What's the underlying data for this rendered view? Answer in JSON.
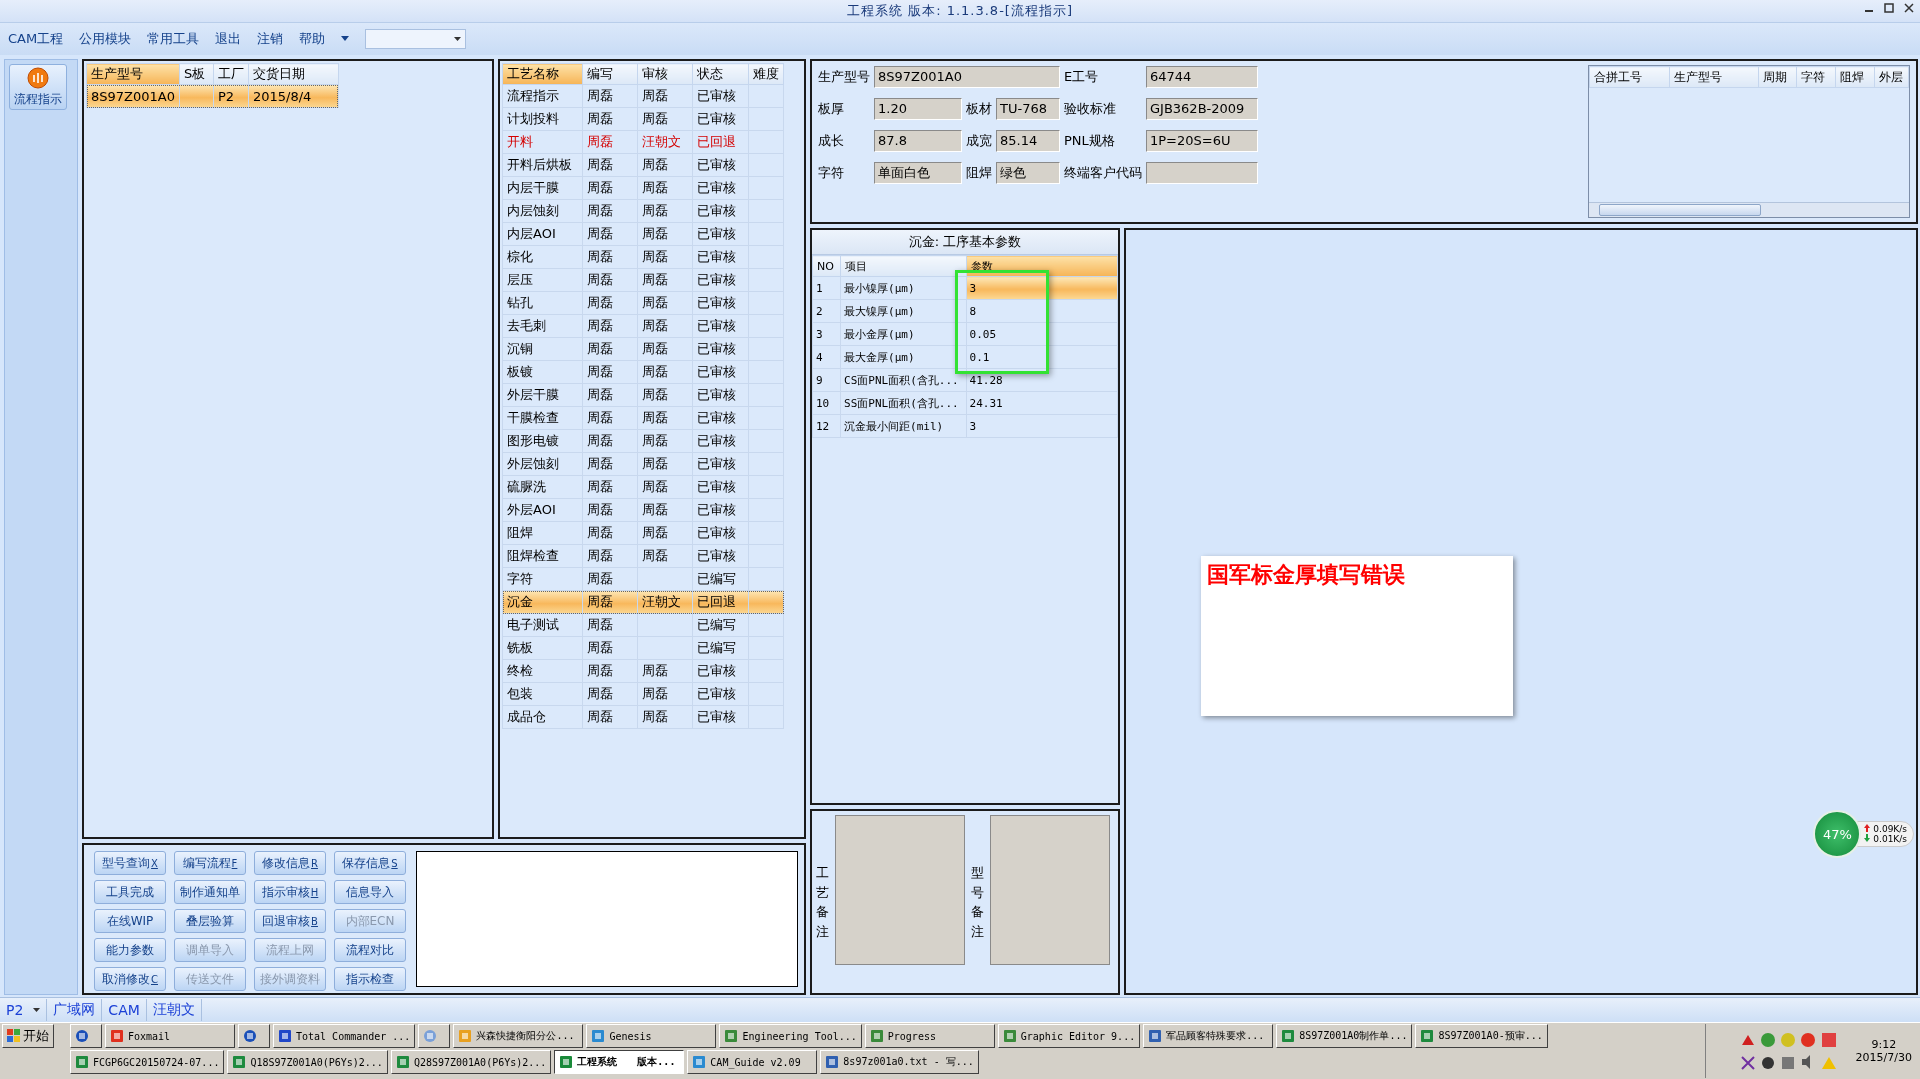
{
  "window": {
    "title": "工程系统 版本: 1.1.3.8-[流程指示]"
  },
  "menu": {
    "items": [
      "CAM工程",
      "公用模块",
      "常用工具",
      "退出",
      "注销",
      "帮助"
    ]
  },
  "sidebar": {
    "button": "流程指示"
  },
  "orders": {
    "columns": [
      "生产型号",
      "S板",
      "工厂",
      "交货日期"
    ],
    "rows": [
      {
        "cells": [
          "8S97Z001A0",
          "",
          "P2",
          "2015/8/4"
        ],
        "selected": true
      }
    ]
  },
  "process": {
    "columns": [
      "工艺名称",
      "编写",
      "审核",
      "状态",
      "难度"
    ],
    "rows": [
      {
        "cells": [
          "流程指示",
          "周磊",
          "周磊",
          "已审核",
          ""
        ],
        "flagged": false,
        "selected": false
      },
      {
        "cells": [
          "计划投料",
          "周磊",
          "周磊",
          "已审核",
          ""
        ],
        "flagged": false,
        "selected": false
      },
      {
        "cells": [
          "开料",
          "周磊",
          "汪朝文",
          "已回退",
          ""
        ],
        "flagged": true,
        "selected": false
      },
      {
        "cells": [
          "开料后烘板",
          "周磊",
          "周磊",
          "已审核",
          ""
        ],
        "flagged": false,
        "selected": false
      },
      {
        "cells": [
          "内层干膜",
          "周磊",
          "周磊",
          "已审核",
          ""
        ],
        "flagged": false,
        "selected": false
      },
      {
        "cells": [
          "内层蚀刻",
          "周磊",
          "周磊",
          "已审核",
          ""
        ],
        "flagged": false,
        "selected": false
      },
      {
        "cells": [
          "内层AOI",
          "周磊",
          "周磊",
          "已审核",
          ""
        ],
        "flagged": false,
        "selected": false
      },
      {
        "cells": [
          "棕化",
          "周磊",
          "周磊",
          "已审核",
          ""
        ],
        "flagged": false,
        "selected": false
      },
      {
        "cells": [
          "层压",
          "周磊",
          "周磊",
          "已审核",
          ""
        ],
        "flagged": false,
        "selected": false
      },
      {
        "cells": [
          "钻孔",
          "周磊",
          "周磊",
          "已审核",
          ""
        ],
        "flagged": false,
        "selected": false
      },
      {
        "cells": [
          "去毛刺",
          "周磊",
          "周磊",
          "已审核",
          ""
        ],
        "flagged": false,
        "selected": false
      },
      {
        "cells": [
          "沉铜",
          "周磊",
          "周磊",
          "已审核",
          ""
        ],
        "flagged": false,
        "selected": false
      },
      {
        "cells": [
          "板镀",
          "周磊",
          "周磊",
          "已审核",
          ""
        ],
        "flagged": false,
        "selected": false
      },
      {
        "cells": [
          "外层干膜",
          "周磊",
          "周磊",
          "已审核",
          ""
        ],
        "flagged": false,
        "selected": false
      },
      {
        "cells": [
          "干膜检查",
          "周磊",
          "周磊",
          "已审核",
          ""
        ],
        "flagged": false,
        "selected": false
      },
      {
        "cells": [
          "图形电镀",
          "周磊",
          "周磊",
          "已审核",
          ""
        ],
        "flagged": false,
        "selected": false
      },
      {
        "cells": [
          "外层蚀刻",
          "周磊",
          "周磊",
          "已审核",
          ""
        ],
        "flagged": false,
        "selected": false
      },
      {
        "cells": [
          "硫脲洗",
          "周磊",
          "周磊",
          "已审核",
          ""
        ],
        "flagged": false,
        "selected": false
      },
      {
        "cells": [
          "外层AOI",
          "周磊",
          "周磊",
          "已审核",
          ""
        ],
        "flagged": false,
        "selected": false
      },
      {
        "cells": [
          "阻焊",
          "周磊",
          "周磊",
          "已审核",
          ""
        ],
        "flagged": false,
        "selected": false
      },
      {
        "cells": [
          "阻焊检查",
          "周磊",
          "周磊",
          "已审核",
          ""
        ],
        "flagged": false,
        "selected": false
      },
      {
        "cells": [
          "字符",
          "周磊",
          "",
          "已编写",
          ""
        ],
        "flagged": false,
        "selected": false
      },
      {
        "cells": [
          "沉金",
          "周磊",
          "汪朝文",
          "已回退",
          ""
        ],
        "flagged": false,
        "selected": true
      },
      {
        "cells": [
          "电子测试",
          "周磊",
          "",
          "已编写",
          ""
        ],
        "flagged": false,
        "selected": false
      },
      {
        "cells": [
          "铣板",
          "周磊",
          "",
          "已编写",
          ""
        ],
        "flagged": false,
        "selected": false
      },
      {
        "cells": [
          "终检",
          "周磊",
          "周磊",
          "已审核",
          ""
        ],
        "flagged": false,
        "selected": false
      },
      {
        "cells": [
          "包装",
          "周磊",
          "周磊",
          "已审核",
          ""
        ],
        "flagged": false,
        "selected": false
      },
      {
        "cells": [
          "成品仓",
          "周磊",
          "周磊",
          "已审核",
          ""
        ],
        "flagged": false,
        "selected": false
      }
    ]
  },
  "buttons": [
    {
      "label": "型号查询",
      "key": "X",
      "disabled": false
    },
    {
      "label": "编写流程",
      "key": "F",
      "disabled": false
    },
    {
      "label": "修改信息",
      "key": "R",
      "disabled": false
    },
    {
      "label": "保存信息",
      "key": "S",
      "disabled": false
    },
    {
      "label": "工具完成",
      "disabled": false
    },
    {
      "label": "制作通知单",
      "disabled": false
    },
    {
      "label": "指示审核",
      "key": "H",
      "disabled": false
    },
    {
      "label": "信息导入",
      "disabled": false
    },
    {
      "label": "在线WIP",
      "disabled": false
    },
    {
      "label": "叠层验算",
      "disabled": false
    },
    {
      "label": "回退审核",
      "key": "B",
      "disabled": false
    },
    {
      "label": "内部ECN",
      "disabled": true
    },
    {
      "label": "能力参数",
      "disabled": false
    },
    {
      "label": "调单导入",
      "disabled": true
    },
    {
      "label": "流程上网",
      "disabled": true
    },
    {
      "label": "流程对比",
      "disabled": false
    },
    {
      "label": "取消修改",
      "key": "C",
      "disabled": false
    },
    {
      "label": "传送文件",
      "disabled": true
    },
    {
      "label": "接外调资料",
      "disabled": true
    },
    {
      "label": "指示检查",
      "disabled": false
    }
  ],
  "info": {
    "rows": [
      [
        {
          "label": "生产型号",
          "value": "8S97Z001A0"
        },
        "",
        {
          "label": "E工号",
          "value": "64744"
        }
      ],
      [
        {
          "label": "板厚",
          "value": "1.20"
        },
        {
          "label": "板材",
          "value": "TU-768"
        },
        {
          "label": "验收标准",
          "value": "GJB362B-2009"
        }
      ],
      [
        {
          "label": "成长",
          "value": "87.8"
        },
        {
          "label": "成宽",
          "value": "85.14"
        },
        {
          "label": "PNL规格",
          "value": "1P=20S=6U"
        }
      ],
      [
        {
          "label": "字符",
          "value": "单面白色"
        },
        {
          "label": "阻焊",
          "value": "绿色"
        },
        {
          "label": "终端客户代码"
        }
      ]
    ]
  },
  "merge_table": {
    "columns": [
      "合拼工号",
      "生产型号",
      "周期",
      "字符",
      "阻焊",
      "外层"
    ]
  },
  "params": {
    "title": "沉金: 工序基本参数",
    "columns": [
      "NO",
      "项目",
      "参数"
    ],
    "rows": [
      {
        "cells": [
          "1",
          "最小镍厚(μm)",
          "3"
        ],
        "selected": true
      },
      {
        "cells": [
          "2",
          "最大镍厚(μm)",
          "8"
        ],
        "selected": false
      },
      {
        "cells": [
          "3",
          "最小金厚(μm)",
          "0.05"
        ],
        "selected": false
      },
      {
        "cells": [
          "4",
          "最大金厚(μm)",
          "0.1"
        ],
        "selected": false
      },
      {
        "cells": [
          "9",
          "CS面PNL面积(含孔...",
          "41.28"
        ],
        "selected": false
      },
      {
        "cells": [
          "10",
          "SS面PNL面积(含孔...",
          "24.31"
        ],
        "selected": false
      },
      {
        "cells": [
          "12",
          "沉金最小间距(mil)",
          "3"
        ],
        "selected": false
      }
    ]
  },
  "remarks": [
    "工艺备注",
    "型号备注"
  ],
  "note": {
    "text": "国军标金厚填写错误"
  },
  "network": {
    "percent": "47%",
    "up": "0.09K/s",
    "down": "0.01K/s"
  },
  "status_bar": {
    "factory": "P2",
    "items": [
      "广域网",
      "CAM",
      "汪朝文"
    ]
  },
  "taskbar": {
    "start": "开始",
    "row1": [
      {
        "kind": "launcher"
      },
      {
        "kind": "window",
        "label": "Foxmail"
      },
      {
        "kind": "launcher"
      },
      {
        "kind": "window",
        "label": "Total Commander ..."
      },
      {
        "kind": "launcher"
      },
      {
        "kind": "window",
        "label": "兴森快捷衡阳分公..."
      },
      {
        "kind": "window",
        "label": "Genesis"
      },
      {
        "kind": "window",
        "label": "Engineering Tool..."
      },
      {
        "kind": "window",
        "label": "Progress"
      },
      {
        "kind": "window",
        "label": "Graphic Editor 9..."
      },
      {
        "kind": "window",
        "label": "军品顾客特殊要求..."
      },
      {
        "kind": "window",
        "label": "8S97Z001A0制作单..."
      },
      {
        "kind": "window",
        "label": "8S97Z001A0-预审..."
      }
    ],
    "row2": [
      {
        "label": "FCGP6GC20150724-07...",
        "selected": false
      },
      {
        "label": "Q18S97Z001A0(P6Ys)2...",
        "selected": false
      },
      {
        "label": "Q28S97Z001A0(P6Ys)2...",
        "selected": false
      },
      {
        "label": "工程系统　　版本...",
        "selected": true
      },
      {
        "label": "CAM_Guide v2.09",
        "selected": false
      },
      {
        "label": "8s97z001a0.txt - 写...",
        "selected": false
      }
    ],
    "time": "9:12",
    "date": "2015/7/30"
  }
}
